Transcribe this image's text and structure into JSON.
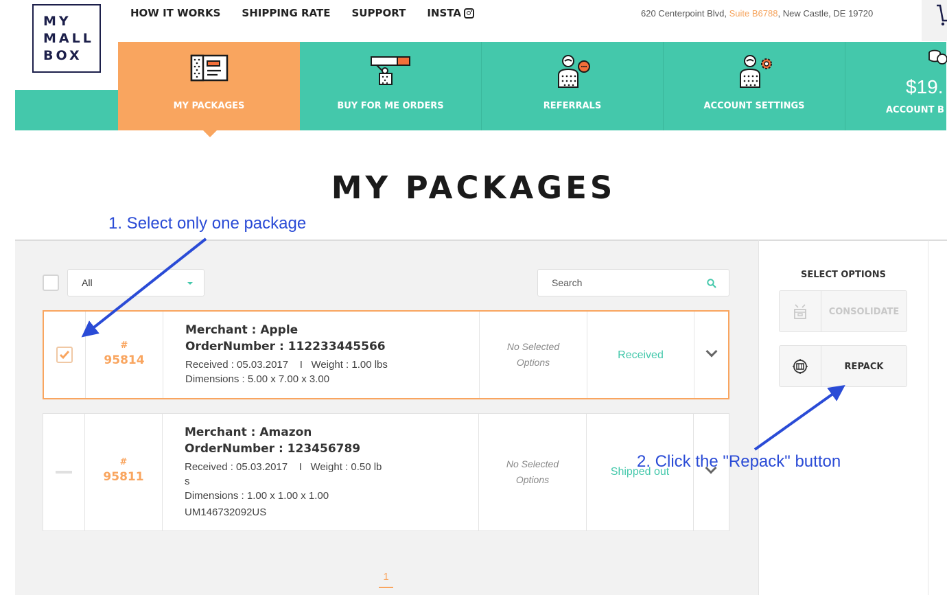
{
  "logo": {
    "lines": [
      "MY",
      "MALL",
      "BOX"
    ]
  },
  "topnav": [
    {
      "label": "HOW IT WORKS"
    },
    {
      "label": "SHIPPING RATE"
    },
    {
      "label": "SUPPORT"
    },
    {
      "label": "INSTA"
    }
  ],
  "address": {
    "street": "620 Centerpoint Blvd, ",
    "suite": "Suite B6788",
    "city": ", New Castle, DE 19720"
  },
  "nav_tiles": [
    {
      "label": "MY PACKAGES",
      "active": true,
      "icon": "packages-icon"
    },
    {
      "label": "BUY FOR ME ORDERS",
      "active": false,
      "icon": "buy-for-me-icon"
    },
    {
      "label": "REFERRALS",
      "active": false,
      "icon": "referrals-icon"
    },
    {
      "label": "ACCOUNT SETTINGS",
      "active": false,
      "icon": "account-settings-icon"
    },
    {
      "label": "ACCOUNT B",
      "amount": "$19.",
      "active": false,
      "icon": "coins-icon"
    }
  ],
  "page_title": "MY PACKAGES",
  "toolbar": {
    "filter_value": "All",
    "search_placeholder": "Search"
  },
  "packages": [
    {
      "hash": "#",
      "number": "95814",
      "merchant": "Merchant : Apple",
      "order_number": "OrderNumber : 112233445566",
      "meta": "Received : 05.03.2017    I   Weight : 1.00 lbs",
      "dimensions": "Dimensions : 5.00 x 7.00 x 3.00",
      "options_line1": "No Selected",
      "options_line2": "Options",
      "status": "Received",
      "selected": true
    },
    {
      "hash": "#",
      "number": "95811",
      "merchant": "Merchant : Amazon",
      "order_number": "OrderNumber : 123456789",
      "meta": "Received : 05.03.2017    I   Weight : 0.50 lb",
      "meta_wrap": "s",
      "dimensions": "Dimensions : 1.00 x 1.00 x 1.00",
      "tracking": "UM146732092US",
      "options_line1": "No Selected",
      "options_line2": "Options",
      "status": "Shipped out",
      "selected": false
    }
  ],
  "side_options": {
    "title": "SELECT OPTIONS",
    "consolidate": {
      "label": "CONSOLIDATE",
      "enabled": false
    },
    "repack": {
      "label": "REPACK",
      "enabled": true
    }
  },
  "pagination": {
    "current": "1"
  },
  "annotations": {
    "step1": "1. Select only one package",
    "step2": "2. Click the \"Repack\" button"
  },
  "colors": {
    "teal": "#44c8ab",
    "orange": "#f9a55f",
    "annotation_blue": "#2a4bd6",
    "navy": "#1c1f4a"
  }
}
